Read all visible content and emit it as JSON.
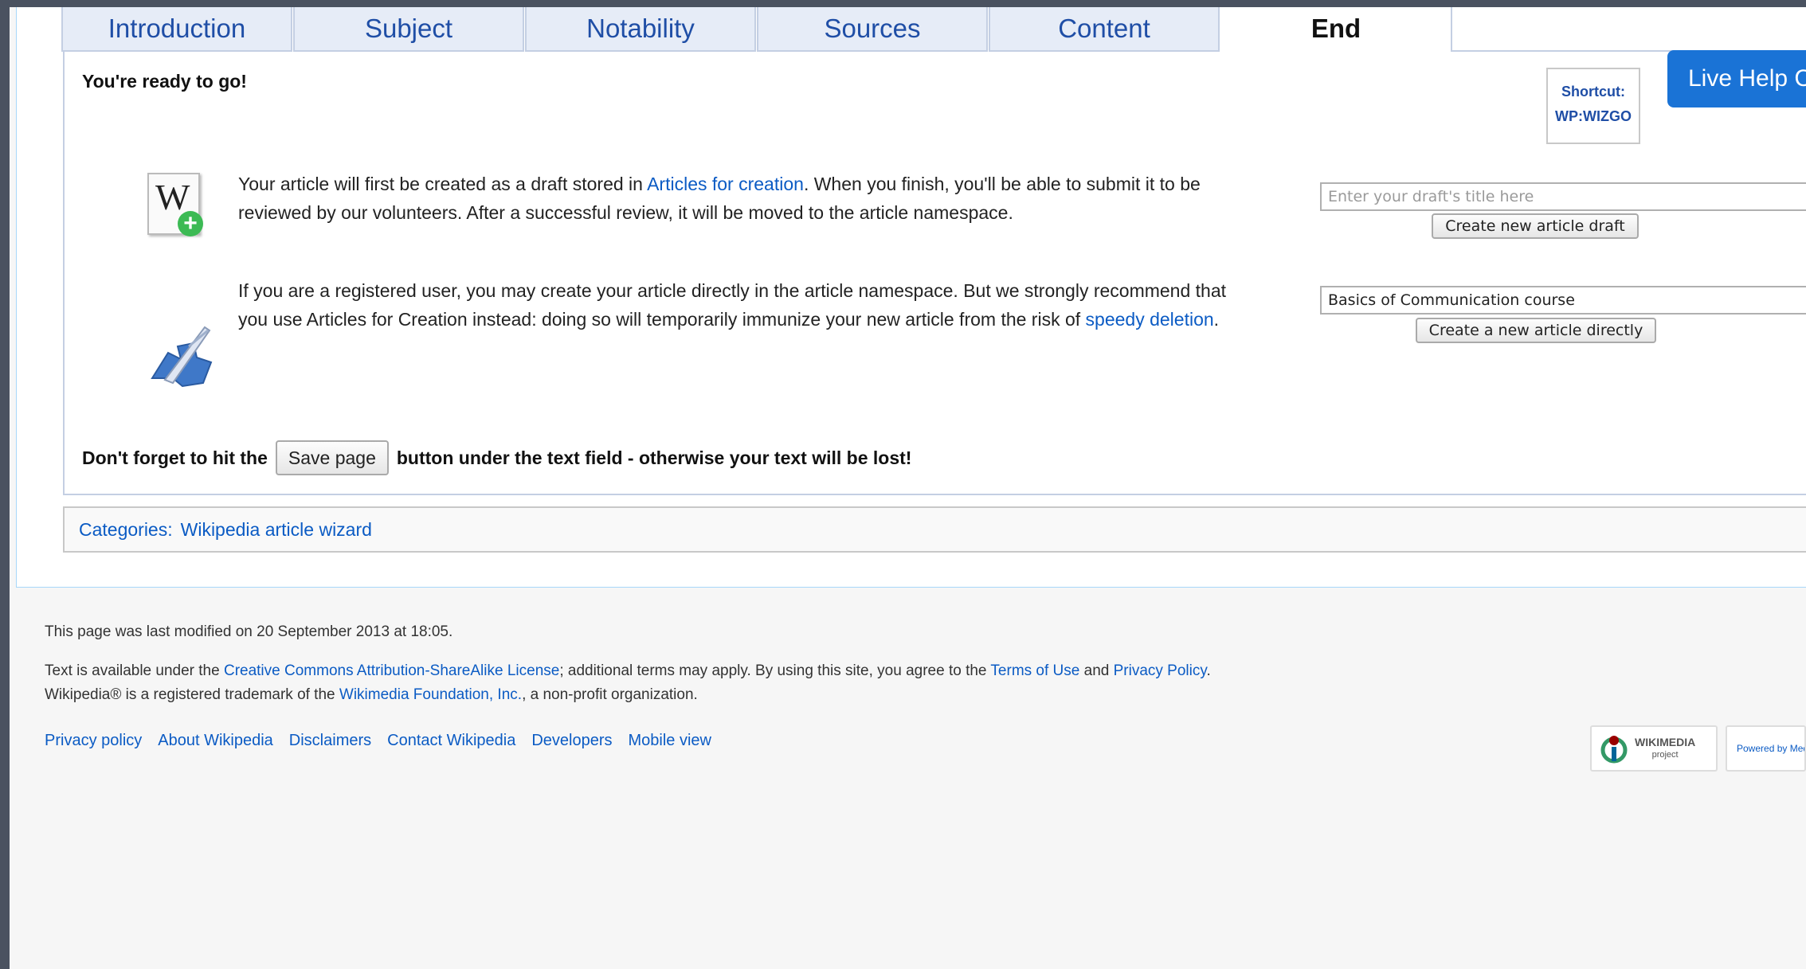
{
  "tabs": [
    "Introduction",
    "Subject",
    "Notability",
    "Sources",
    "Content",
    "End"
  ],
  "active_tab": "End",
  "ready_heading": "You're ready to go!",
  "shortcut": {
    "line1": "Shortcut:",
    "line2": "WP:WIZGO"
  },
  "live_help": "Live Help Ch",
  "draft": {
    "text_before": "Your article will first be created as a draft stored in ",
    "link": "Articles for creation",
    "text_after": ". When you finish, you'll be able to submit it to be reviewed by our volunteers. After a successful review, it will be moved to the article namespace.",
    "placeholder": "Enter your draft's title here",
    "button": "Create new article draft"
  },
  "direct": {
    "text_before": "If you are a registered user, you may create your article directly in the article namespace. But we strongly recommend that you use Articles for Creation instead: doing so will temporarily immunize your new article from the risk of ",
    "link": "speedy deletion",
    "text_after": ".",
    "value": "Basics of Communication course",
    "button": "Create a new article directly"
  },
  "forget": {
    "before": "Don't forget to hit the",
    "button": "Save page",
    "after": "button under the text field - otherwise your text will be lost!"
  },
  "categories": {
    "label": "Categories:",
    "item": "Wikipedia article wizard"
  },
  "footer": {
    "modified": "This page was last modified on 20 September 2013 at 18:05.",
    "license_1": "Text is available under the ",
    "license_link": "Creative Commons Attribution-ShareAlike License",
    "license_2": "; additional terms may apply. By using this site, you agree to the ",
    "terms_link": "Terms of Use",
    "license_3": " and ",
    "privacy_link": "Privacy Policy",
    "license_4": ".",
    "trademark_1": "Wikipedia® is a registered trademark of the ",
    "foundation_link": "Wikimedia Foundation, Inc.",
    "trademark_2": ", a non-profit organization.",
    "links": [
      "Privacy policy",
      "About Wikipedia",
      "Disclaimers",
      "Contact Wikipedia",
      "Developers",
      "Mobile view"
    ],
    "badge_wikimedia": "WIKIMEDIA",
    "badge_wikimedia_sub": "project",
    "badge_mediawiki": "Powered by MediaWiki"
  },
  "colors": {
    "link": "#0b5bc4",
    "live_help_bg": "#1a73d6",
    "tab_bg": "#e6ecf7"
  }
}
